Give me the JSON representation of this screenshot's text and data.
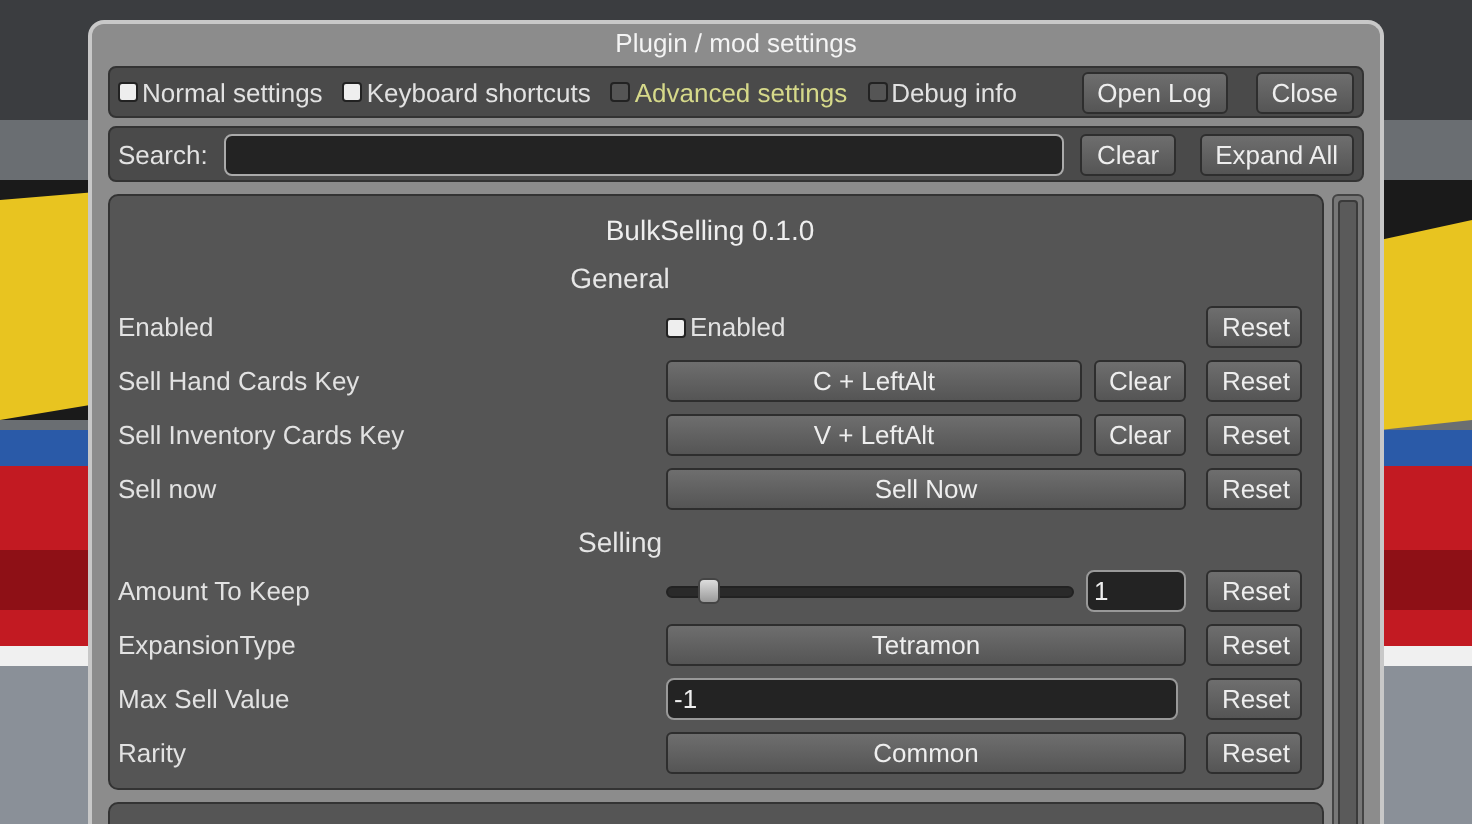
{
  "window": {
    "title": "Plugin / mod settings"
  },
  "toolbar": {
    "toggles": [
      {
        "label": "Normal settings",
        "checked": true,
        "highlighted": false
      },
      {
        "label": "Keyboard shortcuts",
        "checked": true,
        "highlighted": false
      },
      {
        "label": "Advanced settings",
        "checked": false,
        "highlighted": true
      },
      {
        "label": "Debug info",
        "checked": false,
        "highlighted": false
      }
    ],
    "buttons": [
      "Open Log",
      "Close"
    ]
  },
  "search": {
    "label": "Search:",
    "buttons": [
      "Clear",
      "Expand All"
    ]
  },
  "plugin": {
    "title": "BulkSelling 0.1.0",
    "sections": [
      {
        "title": "General",
        "settings": [
          {
            "kind": "checkbox",
            "label": "Enabled",
            "text": "Enabled",
            "checked": true,
            "reset": "Reset"
          },
          {
            "kind": "keybind",
            "label": "Sell Hand Cards Key",
            "value": "C + LeftAlt",
            "clear": "Clear",
            "reset": "Reset"
          },
          {
            "kind": "keybind",
            "label": "Sell Inventory Cards Key",
            "value": "V + LeftAlt",
            "clear": "Clear",
            "reset": "Reset"
          },
          {
            "kind": "button",
            "label": "Sell now",
            "value": "Sell Now",
            "reset": "Reset"
          }
        ]
      },
      {
        "title": "Selling",
        "settings": [
          {
            "kind": "slider",
            "label": "Amount To Keep",
            "level": 0.1,
            "value": "1",
            "reset": "Reset"
          },
          {
            "kind": "choice",
            "label": "ExpansionType",
            "value": "Tetramon",
            "reset": "Reset"
          },
          {
            "kind": "text",
            "label": "Max Sell Value",
            "value": "-1",
            "reset": "Reset"
          },
          {
            "kind": "choice",
            "label": "Rarity",
            "value": "Common",
            "reset": "Reset"
          }
        ]
      }
    ]
  }
}
